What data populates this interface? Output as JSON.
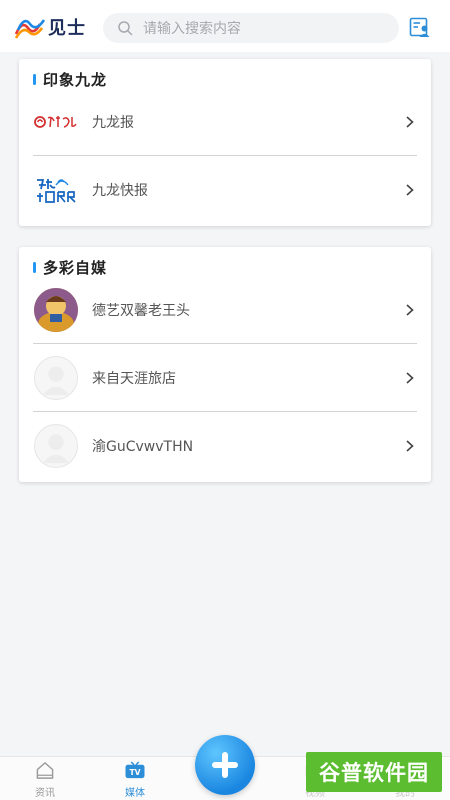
{
  "header": {
    "logo_text": "见士",
    "search_placeholder": "请输入搜索内容"
  },
  "sections": [
    {
      "title": "印象九龙",
      "items": [
        {
          "label": "九龙报",
          "thumb": "jiulongbao-logo"
        },
        {
          "label": "九龙快报",
          "thumb": "jiulong-kuaibao-logo"
        }
      ]
    },
    {
      "title": "多彩自媒",
      "items": [
        {
          "label": "德艺双馨老王头",
          "thumb": "avatar-cartoon"
        },
        {
          "label": "来自天涯旅店",
          "thumb": "avatar-default"
        },
        {
          "label": "渝GuCvwvTHN",
          "thumb": "avatar-default"
        }
      ]
    }
  ],
  "bottom_nav": {
    "items": [
      {
        "label": "资讯",
        "icon": "home-icon",
        "active": false
      },
      {
        "label": "媒体",
        "icon": "tv-icon",
        "active": true
      },
      {
        "label": "视频",
        "icon": "video-icon",
        "active": false
      },
      {
        "label": "我的",
        "icon": "profile-icon",
        "active": false
      }
    ],
    "fab_icon": "plus-icon"
  },
  "watermark": {
    "text": "谷普软件园"
  },
  "colors": {
    "accent": "#2d8ed8",
    "title_bar": "#2196f3",
    "watermark_bg": "#5bbd2f"
  }
}
